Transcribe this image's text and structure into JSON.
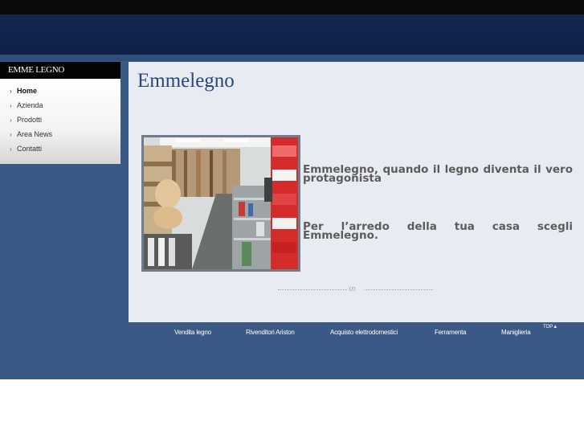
{
  "brand": {
    "name": "EMME LEGNO"
  },
  "menu": {
    "items": [
      {
        "label": "Home",
        "active": true
      },
      {
        "label": "Azienda"
      },
      {
        "label": "Prodotti"
      },
      {
        "label": "Area News"
      },
      {
        "label": "Contatti"
      }
    ]
  },
  "content": {
    "title": "Emmelegno",
    "text1": "Emmelegno, quando il legno diventa il vero protagonista",
    "text2": "Per l’arredo della tua casa scegli Emmelegno.",
    "divider_ornament": "ഗ"
  },
  "footer": {
    "links": [
      "Vendita legno",
      "Rivenditori Ariston",
      "Acquisto elettrodomestici",
      "Ferramenta",
      "Maniglieria"
    ],
    "top_label": "TOP▲"
  },
  "colors": {
    "header": "#0f2148",
    "body_bg": "#3a5a85",
    "content_bg": "#e8ebf2",
    "title": "#26487e"
  }
}
